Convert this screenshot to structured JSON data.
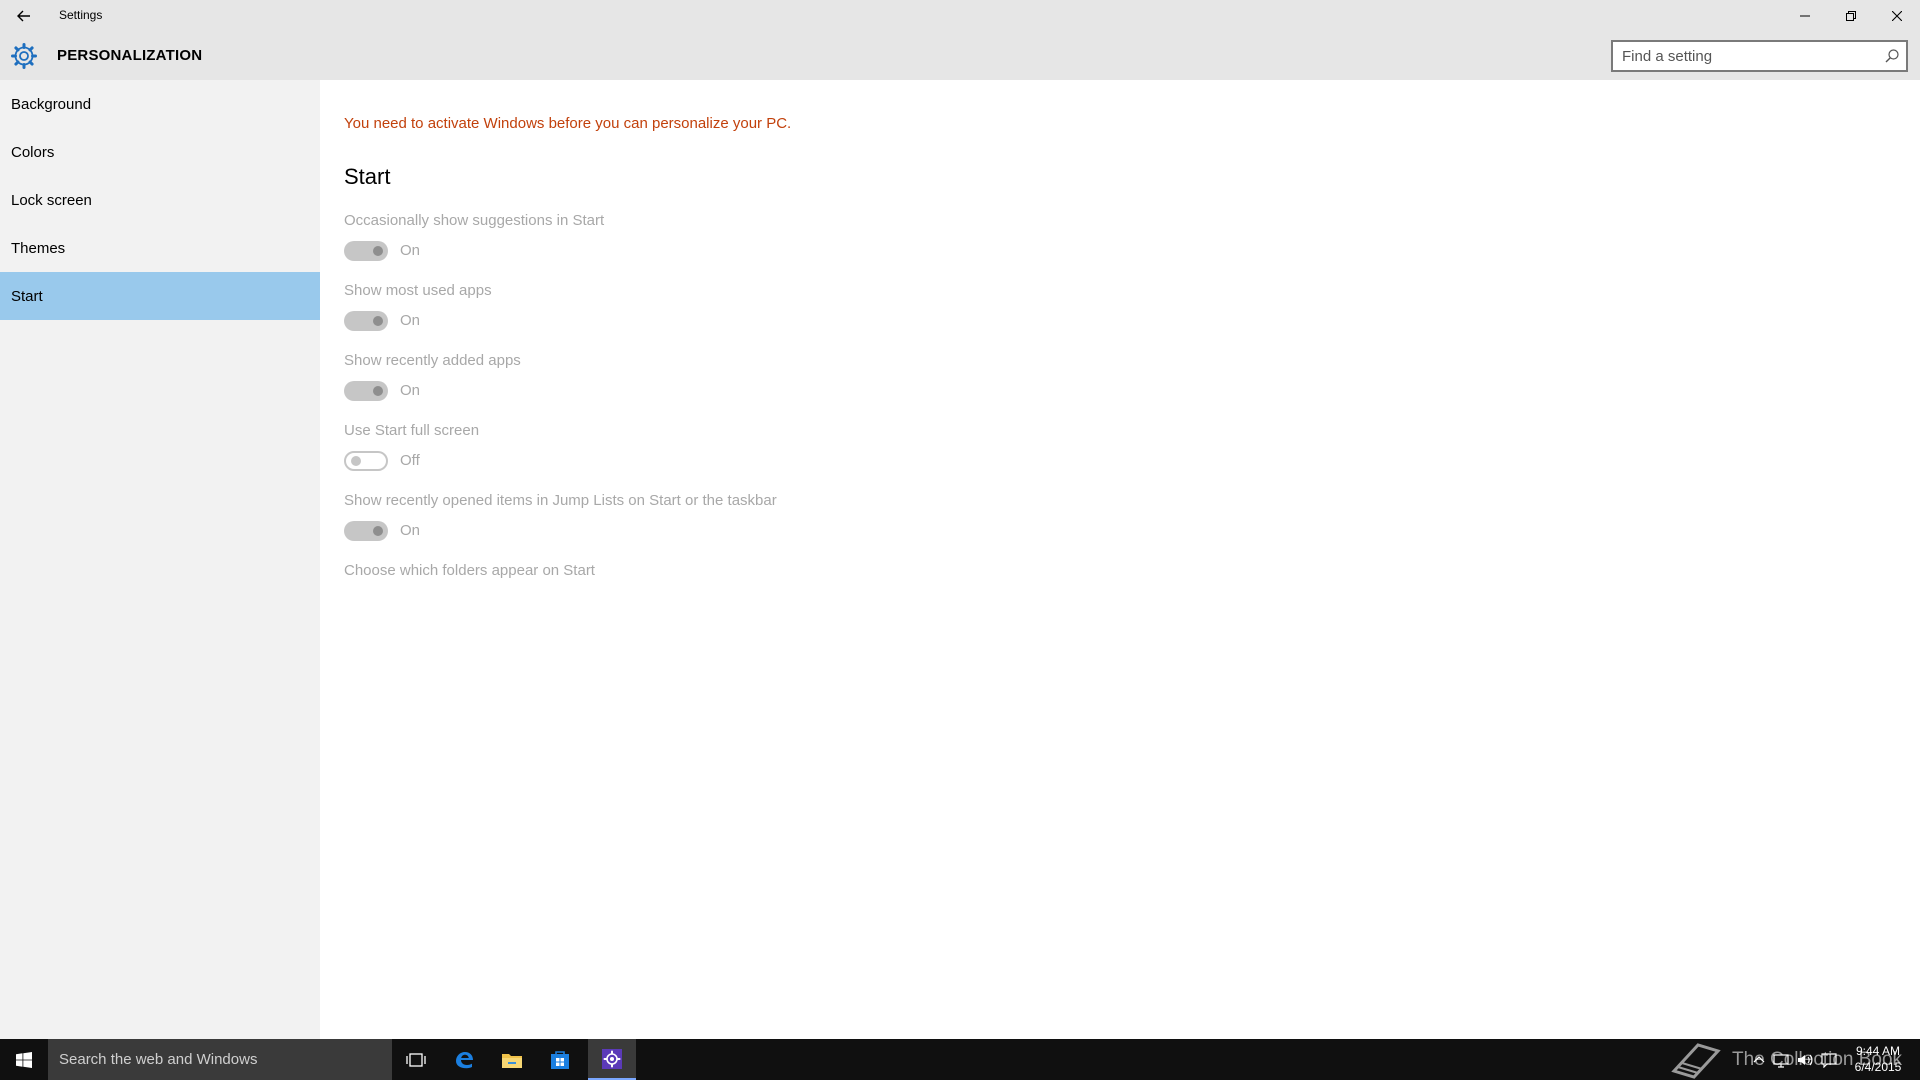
{
  "window": {
    "title": "Settings",
    "icons": {
      "back": "back-arrow-icon",
      "minimize": "minimize-icon",
      "maximize": "restore-icon",
      "close": "close-icon"
    }
  },
  "header": {
    "title": "PERSONALIZATION",
    "icon": "gear-icon",
    "search_placeholder": "Find a setting"
  },
  "sidebar": {
    "items": [
      {
        "label": "Background",
        "selected": false
      },
      {
        "label": "Colors",
        "selected": false
      },
      {
        "label": "Lock screen",
        "selected": false
      },
      {
        "label": "Themes",
        "selected": false
      },
      {
        "label": "Start",
        "selected": true
      }
    ],
    "selected_color": "#99c9ec"
  },
  "content": {
    "warning": "You need to activate Windows before you can personalize your PC.",
    "warning_color": "#c2410c",
    "section_title": "Start",
    "settings": [
      {
        "label": "Occasionally show suggestions in Start",
        "state": "On",
        "on": true
      },
      {
        "label": "Show most used apps",
        "state": "On",
        "on": true
      },
      {
        "label": "Show recently added apps",
        "state": "On",
        "on": true
      },
      {
        "label": "Use Start full screen",
        "state": "Off",
        "on": false
      },
      {
        "label": "Show recently opened items in Jump Lists on Start or the taskbar",
        "state": "On",
        "on": true
      }
    ],
    "link": "Choose which folders appear on Start"
  },
  "taskbar": {
    "search_text": "Search the web and Windows",
    "apps": [
      "task-view-icon",
      "edge-icon",
      "file-explorer-icon",
      "store-icon",
      "settings-icon"
    ],
    "active_app": "settings-icon",
    "watermark": "The Collection Book",
    "clock": {
      "time": "9:44 AM",
      "date": "6/4/2015"
    }
  }
}
